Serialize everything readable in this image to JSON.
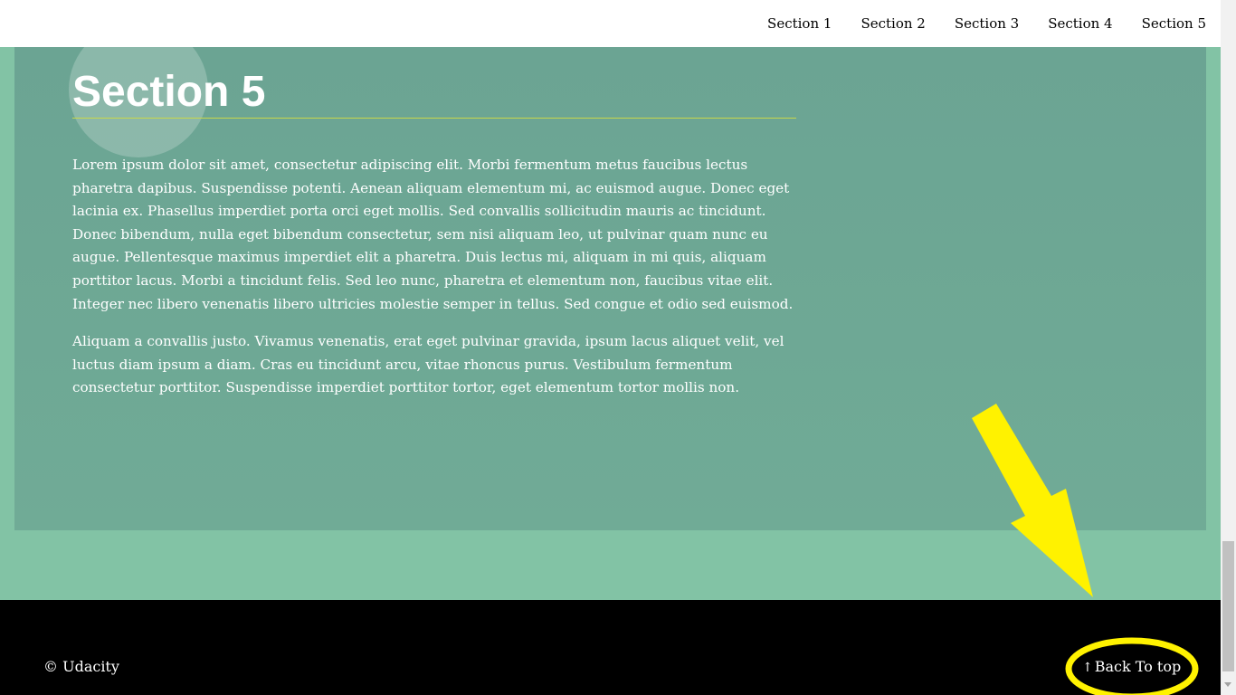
{
  "nav": {
    "items": [
      {
        "label": "Section 1"
      },
      {
        "label": "Section 2"
      },
      {
        "label": "Section 3"
      },
      {
        "label": "Section 4"
      },
      {
        "label": "Section 5"
      }
    ]
  },
  "section": {
    "title": "Section 5",
    "paragraphs": [
      "Lorem ipsum dolor sit amet, consectetur adipiscing elit. Morbi fermentum metus faucibus lectus pharetra dapibus. Suspendisse potenti. Aenean aliquam elementum mi, ac euismod augue. Donec eget lacinia ex. Phasellus imperdiet porta orci eget mollis. Sed convallis sollicitudin mauris ac tincidunt. Donec bibendum, nulla eget bibendum consectetur, sem nisi aliquam leo, ut pulvinar quam nunc eu augue. Pellentesque maximus imperdiet elit a pharetra. Duis lectus mi, aliquam in mi quis, aliquam porttitor lacus. Morbi a tincidunt felis. Sed leo nunc, pharetra et elementum non, faucibus vitae elit. Integer nec libero venenatis libero ultricies molestie semper in tellus. Sed congue et odio sed euismod.",
      "Aliquam a convallis justo. Vivamus venenatis, erat eget pulvinar gravida, ipsum lacus aliquet velit, vel luctus diam ipsum a diam. Cras eu tincidunt arcu, vitae rhoncus purus. Vestibulum fermentum consectetur porttitor. Suspendisse imperdiet porttitor tortor, eget elementum tortor mollis non."
    ]
  },
  "footer": {
    "copyright": "© Udacity",
    "back_to_top": "Back To top",
    "back_to_top_icon": "↑"
  },
  "colors": {
    "page_bg": "#82c3a5",
    "section_bg": "#6ba493",
    "title_rule": "#c9d84a",
    "footer_bg": "#000000",
    "annotation": "#fff200"
  },
  "icons": {
    "back_to_top": "arrow-up-icon",
    "annotation_arrow": "pointer-arrow-icon",
    "annotation_highlight": "highlight-ellipse-icon"
  }
}
